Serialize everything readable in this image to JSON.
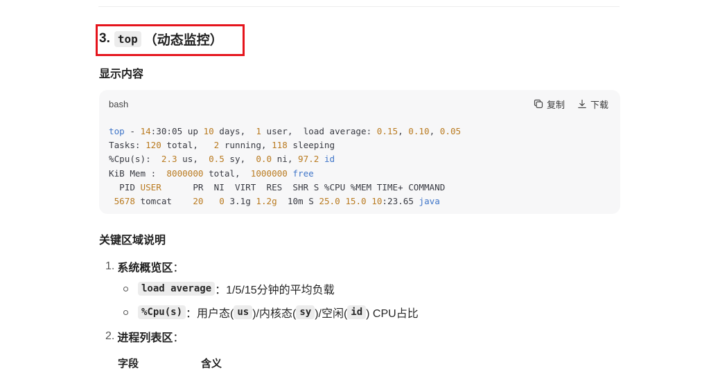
{
  "section": {
    "number": "3.",
    "code": "top",
    "title_rest": "（动态监控）"
  },
  "display_heading": "显示内容",
  "code_block": {
    "language": "bash",
    "copy_label": "复制",
    "download_label": "下载",
    "lines": [
      [
        [
          "top",
          "b"
        ],
        [
          " - ",
          ""
        ],
        [
          "14",
          "n"
        ],
        [
          ":30:05 up ",
          ""
        ],
        [
          "10",
          "n"
        ],
        [
          " days,  ",
          ""
        ],
        [
          "1",
          "n"
        ],
        [
          " user,  load average: ",
          ""
        ],
        [
          "0.15",
          "n"
        ],
        [
          ", ",
          ""
        ],
        [
          "0.10",
          "n"
        ],
        [
          ", ",
          ""
        ],
        [
          "0.05",
          "n"
        ]
      ],
      [
        [
          "Tasks: ",
          ""
        ],
        [
          "120",
          "n"
        ],
        [
          " total,   ",
          ""
        ],
        [
          "2",
          "n"
        ],
        [
          " running, ",
          ""
        ],
        [
          "118",
          "n"
        ],
        [
          " sleeping",
          ""
        ]
      ],
      [
        [
          "%Cpu(s):  ",
          ""
        ],
        [
          "2.3",
          "n"
        ],
        [
          " us,  ",
          ""
        ],
        [
          "0.5",
          "n"
        ],
        [
          " sy,  ",
          ""
        ],
        [
          "0.0",
          "n"
        ],
        [
          " ni, ",
          ""
        ],
        [
          "97.2",
          "n"
        ],
        [
          " ",
          ""
        ],
        [
          "id",
          "b"
        ]
      ],
      [
        [
          "KiB Mem :  ",
          ""
        ],
        [
          "8000000",
          "n"
        ],
        [
          " total,  ",
          ""
        ],
        [
          "1000000",
          "n"
        ],
        [
          " ",
          ""
        ],
        [
          "free",
          "b"
        ]
      ],
      [
        [
          "  PID ",
          ""
        ],
        [
          "USER",
          "n"
        ],
        [
          "      PR  NI  VIRT  RES  SHR S %CPU %MEM TIME+ COMMAND",
          ""
        ]
      ],
      [
        [
          " ",
          ""
        ],
        [
          "5678",
          "n"
        ],
        [
          " tomcat    ",
          ""
        ],
        [
          "20",
          "n"
        ],
        [
          "   ",
          ""
        ],
        [
          "0",
          "n"
        ],
        [
          " 3.1g ",
          ""
        ],
        [
          "1.2g",
          "n"
        ],
        [
          "  10m S ",
          ""
        ],
        [
          "25.0",
          "n"
        ],
        [
          " ",
          ""
        ],
        [
          "15.0",
          "n"
        ],
        [
          " ",
          ""
        ],
        [
          "10",
          "n"
        ],
        [
          ":23.65 ",
          ""
        ],
        [
          "java",
          "b"
        ]
      ]
    ]
  },
  "key_heading": "关键区域说明",
  "list": {
    "item1": {
      "index": "1.",
      "title": "系统概览区",
      "colon": "："
    },
    "bullet1": {
      "code": "load average",
      "text": "：1/5/15分钟的平均负载"
    },
    "bullet2": {
      "code": "%Cpu(s)",
      "text_a": "：用户态(",
      "code_us": "us",
      "text_b": ")/内核态(",
      "code_sy": "sy",
      "text_c": ")/空闲(",
      "code_id": "id",
      "text_d": ") CPU占比"
    },
    "item2": {
      "index": "2.",
      "title": "进程列表区",
      "colon": "："
    }
  },
  "table": {
    "headers": [
      "字段",
      "含义"
    ]
  },
  "colors": {
    "highlight_box": "#e5141c",
    "token_blue": "#3f75c8",
    "token_number": "#b97a1f",
    "code_bg": "#f7f7f8"
  }
}
